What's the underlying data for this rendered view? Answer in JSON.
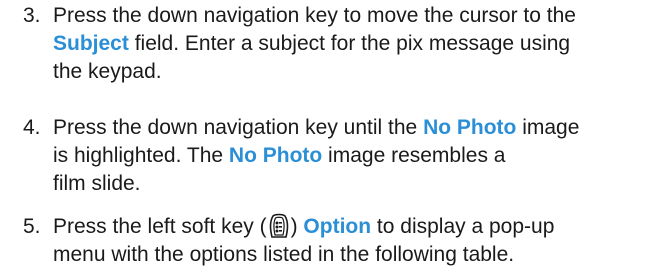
{
  "steps": [
    {
      "number": "3.",
      "lines": [
        {
          "t1": "Press the down navigation key to move the cursor to the"
        },
        {
          "h": "Subject",
          "t2": " field. Enter a subject for the pix message using"
        },
        {
          "t1": "the keypad."
        }
      ]
    },
    {
      "number": "4.",
      "lines": [
        {
          "t1": "Press the down navigation key until the ",
          "h": "No Photo",
          "t2": " image"
        },
        {
          "t1": "is highlighted. The ",
          "h": "No Photo",
          "t2": " image resembles a"
        },
        {
          "t1": "film slide."
        }
      ]
    },
    {
      "number": "5.",
      "lines": [
        {
          "t1": "Press the left soft key (",
          "icon": "left-soft-key-icon",
          "t2": ") ",
          "h": "Option",
          "t3": " to display a pop-up"
        },
        {
          "t1": "menu with the options listed in the following table."
        }
      ]
    }
  ],
  "colors": {
    "highlight": "#2a8fd6",
    "text": "#1a1a1a"
  }
}
